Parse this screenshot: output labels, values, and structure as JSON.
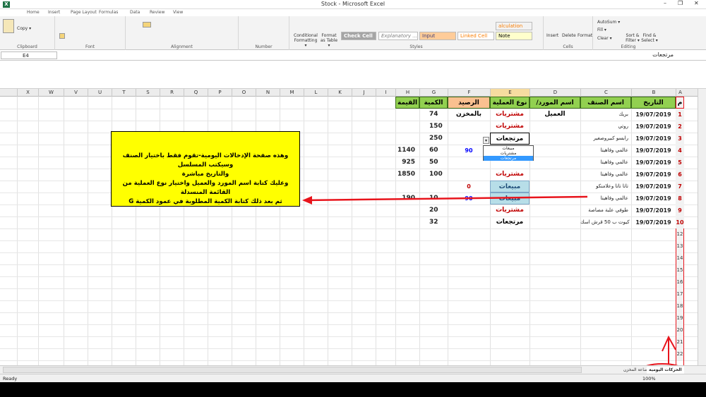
{
  "window": {
    "title": "Stock - Microsoft Excel"
  },
  "tabs": [
    "Home",
    "Insert",
    "Page Layout",
    "Formulas",
    "Data",
    "Review",
    "View"
  ],
  "ribbon": {
    "clipboard": {
      "label": "Clipboard",
      "copy": "Copy ▾"
    },
    "font": {
      "label": "Font"
    },
    "alignment": {
      "label": "Alignment"
    },
    "number": {
      "label": "Number"
    },
    "styles": {
      "label": "Styles",
      "conditional": "Conditional",
      "formatting": "Formatting ▾",
      "format": "Format",
      "as_table": "as Table ▾",
      "check_cell": "Check Cell",
      "explanatory": "Explanatory ...",
      "input": "Input",
      "linked_cell": "Linked Cell",
      "note": "Note",
      "calculation": "alculation"
    },
    "cells": {
      "label": "Cells",
      "insert": "Insert",
      "delete": "Delete",
      "format": "Format"
    },
    "editing": {
      "label": "Editing",
      "autosum": "AutoSum ▾",
      "fill": "Fill ▾",
      "clear": "Clear ▾",
      "sort": "Sort &",
      "filter": "Filter ▾",
      "find": "Find &",
      "select": "Select ▾"
    }
  },
  "formula_bar": {
    "name_box": "E4",
    "content": "مرتجعات"
  },
  "columns": [
    "X",
    "W",
    "V",
    "U",
    "T",
    "S",
    "R",
    "Q",
    "P",
    "O",
    "N",
    "M",
    "L",
    "K",
    "J",
    "I",
    "H",
    "G",
    "F",
    "E",
    "D",
    "C",
    "B",
    "A"
  ],
  "headers": {
    "h": "القيمة",
    "g": "الكمية",
    "f": "الرصيد بالمخزن",
    "e": "نوع العملية",
    "d": "اسم المورد/العميل",
    "c": "اسم الصنف",
    "b": "التاريخ",
    "a": "م"
  },
  "rows": [
    {
      "n": "1",
      "date": "19/07/2019",
      "item": "بريك",
      "op": "مشتريات",
      "qty": "74",
      "bal": "",
      "val": ""
    },
    {
      "n": "2",
      "date": "19/07/2019",
      "item": "روتي",
      "op": "مشتريات",
      "qty": "150",
      "bal": "",
      "val": ""
    },
    {
      "n": "3",
      "date": "19/07/2019",
      "item": "رابسو كبيروصغير",
      "op": "مرتجعات",
      "qty": "250",
      "bal": "",
      "val": ""
    },
    {
      "n": "4",
      "date": "19/07/2019",
      "item": "عالمي وفاهيتا",
      "op": "",
      "qty": "60",
      "bal": "90",
      "val": "1140"
    },
    {
      "n": "5",
      "date": "19/07/2019",
      "item": "عالمي وفاهيتا",
      "op": "",
      "qty": "50",
      "bal": "",
      "val": "925"
    },
    {
      "n": "6",
      "date": "19/07/2019",
      "item": "عالمي وفاهيتا",
      "op": "مشتريات",
      "qty": "100",
      "bal": "",
      "val": "1850"
    },
    {
      "n": "7",
      "date": "19/07/2019",
      "item": "تاتا تاتا وعلامنكو",
      "op": "مبيعات",
      "qty": "",
      "bal": "0",
      "val": ""
    },
    {
      "n": "8",
      "date": "19/07/2019",
      "item": "عالمي وفاهيتا",
      "op": "مبيعات",
      "qty": "10",
      "bal": "90",
      "val": "190"
    },
    {
      "n": "9",
      "date": "19/07/2019",
      "item": "طوفي علبة مصاصة",
      "op": "مشتريات",
      "qty": "20",
      "bal": "",
      "val": ""
    },
    {
      "n": "10",
      "date": "19/07/2019",
      "item": "كيوت ب 50 قرش اسك",
      "op": "مرتجعات",
      "qty": "32",
      "bal": "",
      "val": ""
    }
  ],
  "dropdown": {
    "options": [
      "مبيعات",
      "مشتريات",
      "مرتجعات"
    ]
  },
  "note": {
    "line1": "وهذه صفحة الإدخالات اليومية-تقوم فقط باختيار الصنف وسيكتب المسلسل",
    "line2": "والتاريخ مباشرة",
    "line3": "وعليك كتابة اسم المورد والعميل واختيار نوع العملية من القائمة المنسدلة",
    "line4": "ثم بعد ذلك كتابة الكمية المطلوبة في عمود الكمية G"
  },
  "sheet_tabs": {
    "active": "الحركات اليومية",
    "other": "بضاعة المخزن"
  },
  "status": {
    "ready": "Ready",
    "zoom": "100%"
  },
  "colors": {
    "header_green": "#92d050",
    "red": "#c00000",
    "blue": "#0000ff",
    "note_yellow": "#ffff00",
    "arrow": "#e8141c"
  }
}
